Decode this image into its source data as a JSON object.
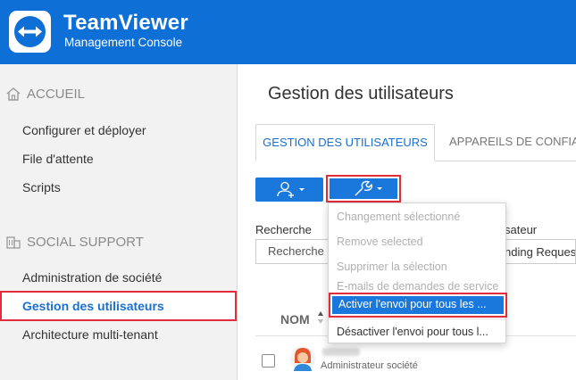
{
  "header": {
    "brand": "TeamViewer",
    "subtitle": "Management Console",
    "logo_icon": "teamviewer-arrows-icon",
    "background": "#0e6fd6"
  },
  "sidebar": {
    "sections": [
      {
        "title": "ACCUEIL",
        "icon": "home-icon",
        "items": [
          "Configurer et déployer",
          "File d'attente",
          "Scripts"
        ]
      },
      {
        "title": "SOCIAL SUPPORT",
        "icon": "building-icon",
        "items": [
          "Administration de société",
          "Gestion des utilisateurs",
          "Architecture multi-tenant"
        ]
      }
    ],
    "active_item": "Gestion des utilisateurs"
  },
  "main": {
    "title": "Gestion des utilisateurs",
    "tabs": [
      {
        "label": "GESTION DES UTILISATEURS",
        "active": true
      },
      {
        "label": "APPAREILS DE CONFIAI",
        "active": false
      }
    ],
    "toolbar": {
      "add_user_icon": "add-user-icon",
      "tools_icon": "wrench-icon"
    },
    "filters": {
      "search_label": "Recherche",
      "search_placeholder": "Recherche",
      "user_label_partial": "sateur",
      "user_value_partial": "nding Request"
    },
    "table": {
      "column_name": "NOM",
      "rows": [
        {
          "role": "Administrateur société"
        }
      ]
    }
  },
  "dropdown": {
    "items": [
      {
        "label": "Changement sélectionné",
        "enabled": false
      },
      {
        "label": "Remove selected",
        "enabled": false
      },
      {
        "label": "Supprimer la sélection",
        "enabled": false
      },
      {
        "label": "E-mails de demandes de service",
        "enabled": false
      },
      {
        "label": "Activer l'envoi pour tous les ...",
        "enabled": true,
        "highlighted": true
      },
      {
        "label": "Désactiver l'envoi pour tous l...",
        "enabled": true
      }
    ]
  },
  "colors": {
    "accent": "#1a78dc",
    "highlight_border": "#e32c3b",
    "active_nav_text": "#1a6fd0"
  }
}
